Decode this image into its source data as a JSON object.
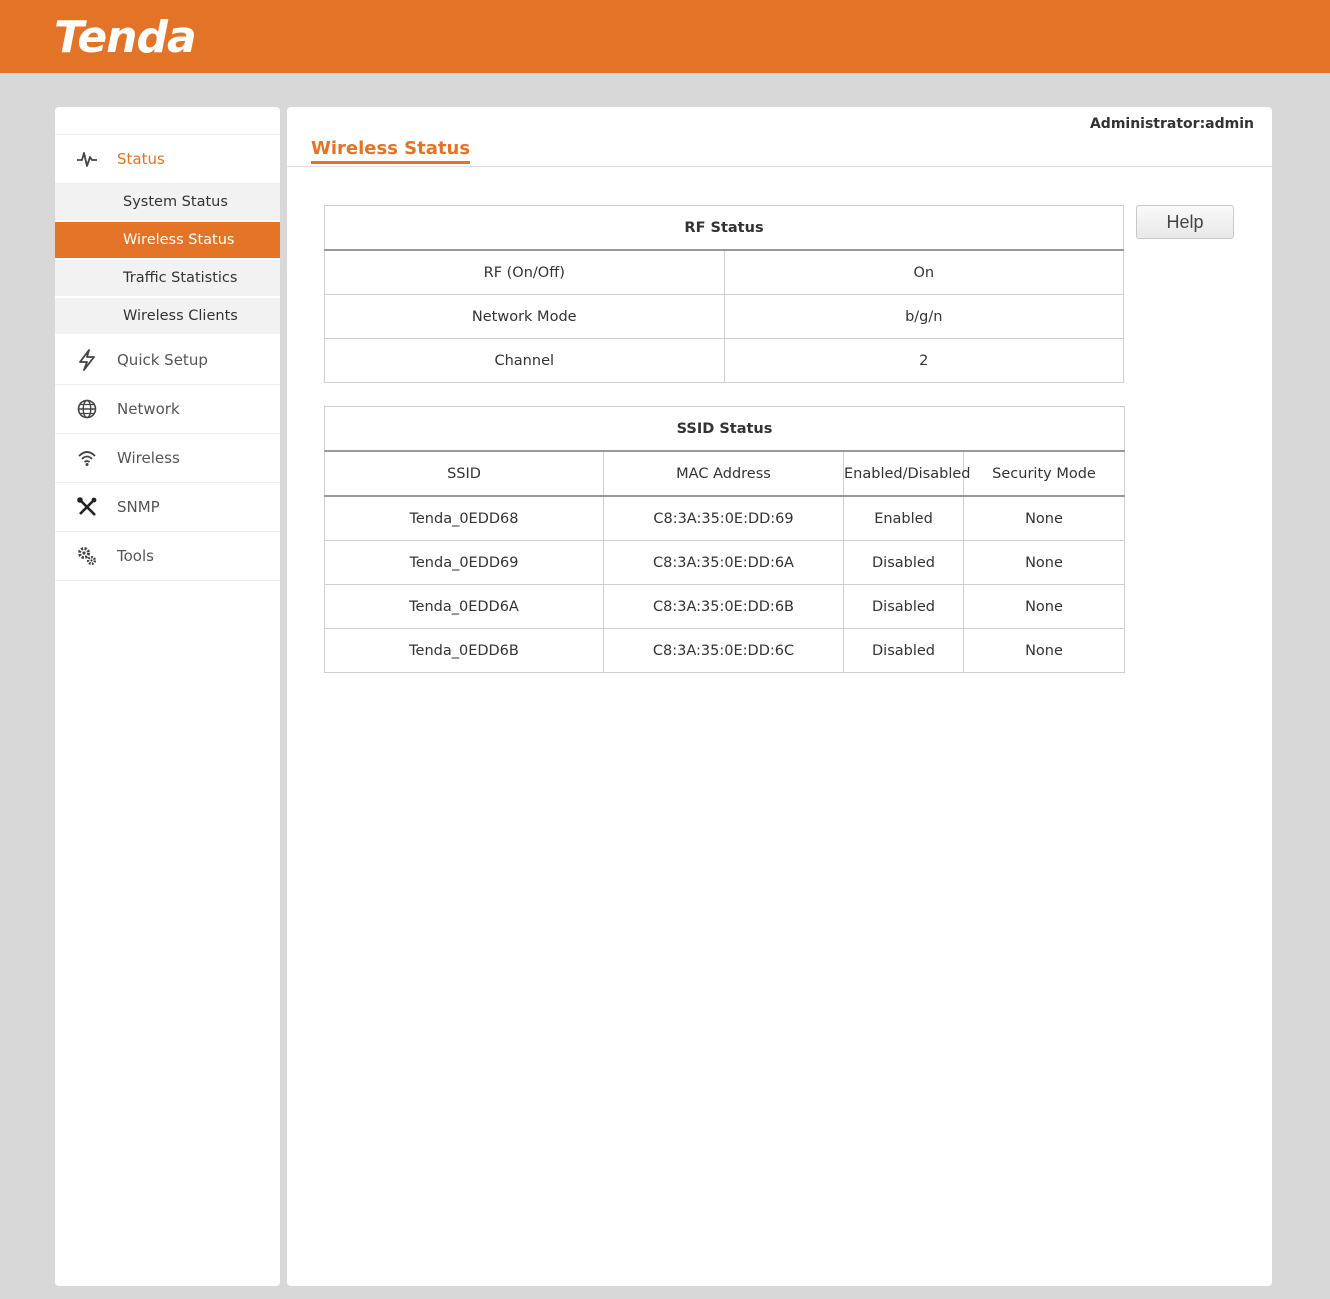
{
  "brand": {
    "logo_text": "Tenda",
    "accent": "#e37326"
  },
  "header": {
    "admin_label": "Administrator:admin"
  },
  "sidebar": {
    "status": {
      "label": "Status",
      "icon": "pulse-icon",
      "subitems": [
        {
          "label": "System Status"
        },
        {
          "label": "Wireless Status",
          "active": true
        },
        {
          "label": "Traffic Statistics"
        },
        {
          "label": "Wireless Clients"
        }
      ]
    },
    "items": [
      {
        "label": "Quick Setup",
        "icon": "lightning-icon"
      },
      {
        "label": "Network",
        "icon": "globe-icon"
      },
      {
        "label": "Wireless",
        "icon": "wifi-icon"
      },
      {
        "label": "SNMP",
        "icon": "tools-icon"
      },
      {
        "label": "Tools",
        "icon": "gears-icon"
      }
    ]
  },
  "main": {
    "title": "Wireless Status",
    "help_label": "Help",
    "rf": {
      "caption": "RF Status",
      "rows": [
        {
          "label": "RF (On/Off)",
          "value": "On"
        },
        {
          "label": "Network Mode",
          "value": "b/g/n"
        },
        {
          "label": "Channel",
          "value": "2"
        }
      ]
    },
    "ssid": {
      "caption": "SSID Status",
      "headers": [
        "SSID",
        "MAC Address",
        "Enabled/Disabled",
        "Security Mode"
      ],
      "rows": [
        [
          "Tenda_0EDD68",
          "C8:3A:35:0E:DD:69",
          "Enabled",
          "None"
        ],
        [
          "Tenda_0EDD69",
          "C8:3A:35:0E:DD:6A",
          "Disabled",
          "None"
        ],
        [
          "Tenda_0EDD6A",
          "C8:3A:35:0E:DD:6B",
          "Disabled",
          "None"
        ],
        [
          "Tenda_0EDD6B",
          "C8:3A:35:0E:DD:6C",
          "Disabled",
          "None"
        ]
      ]
    }
  }
}
